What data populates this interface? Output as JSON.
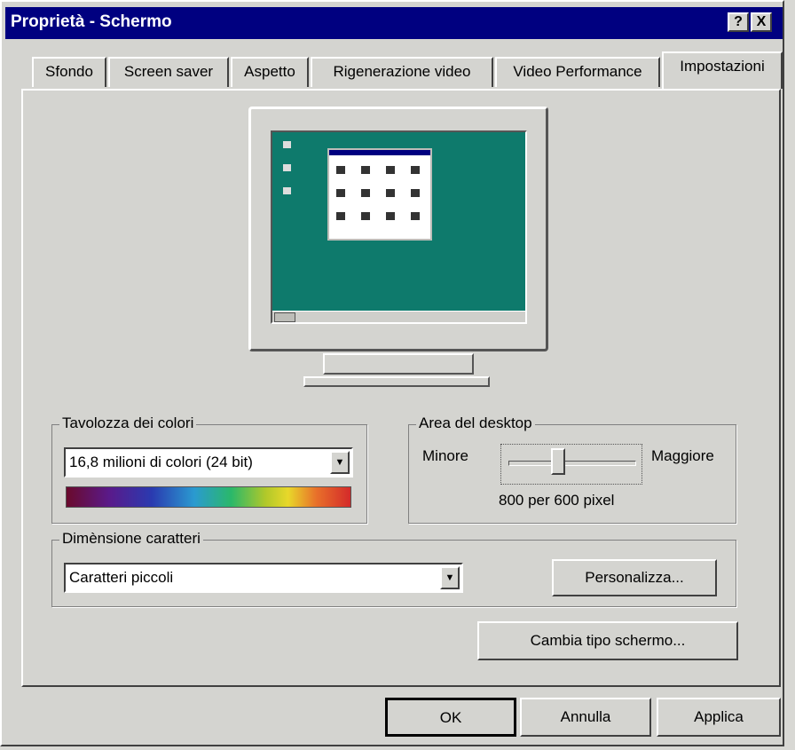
{
  "window": {
    "title": "Proprietà - Schermo",
    "help_btn": "?",
    "close_btn": "X"
  },
  "tabs": [
    {
      "label": "Sfondo"
    },
    {
      "label": "Screen saver"
    },
    {
      "label": "Aspetto"
    },
    {
      "label": "Rigenerazione video"
    },
    {
      "label": "Video Performance"
    },
    {
      "label": "Impostazioni",
      "active": true
    }
  ],
  "color_palette": {
    "group_label": "Tavolozza dei colori",
    "selected": "16,8 milioni di colori (24 bit)"
  },
  "desktop_area": {
    "group_label": "Area del desktop",
    "min_label": "Minore",
    "max_label": "Maggiore",
    "resolution_text": "800 per 600 pixel",
    "slider_value_fraction": 0.38
  },
  "font_size": {
    "group_label": "Dimènsione caratteri",
    "selected": "Caratteri piccoli",
    "customize_button": "Personalizza..."
  },
  "change_display_button": "Cambia tipo schermo...",
  "footer": {
    "ok": "OK",
    "cancel": "Annulla",
    "apply": "Applica"
  },
  "colors": {
    "title_bar": "#000080",
    "desktop": "#0e7a6c",
    "face": "#d4d4d0"
  }
}
